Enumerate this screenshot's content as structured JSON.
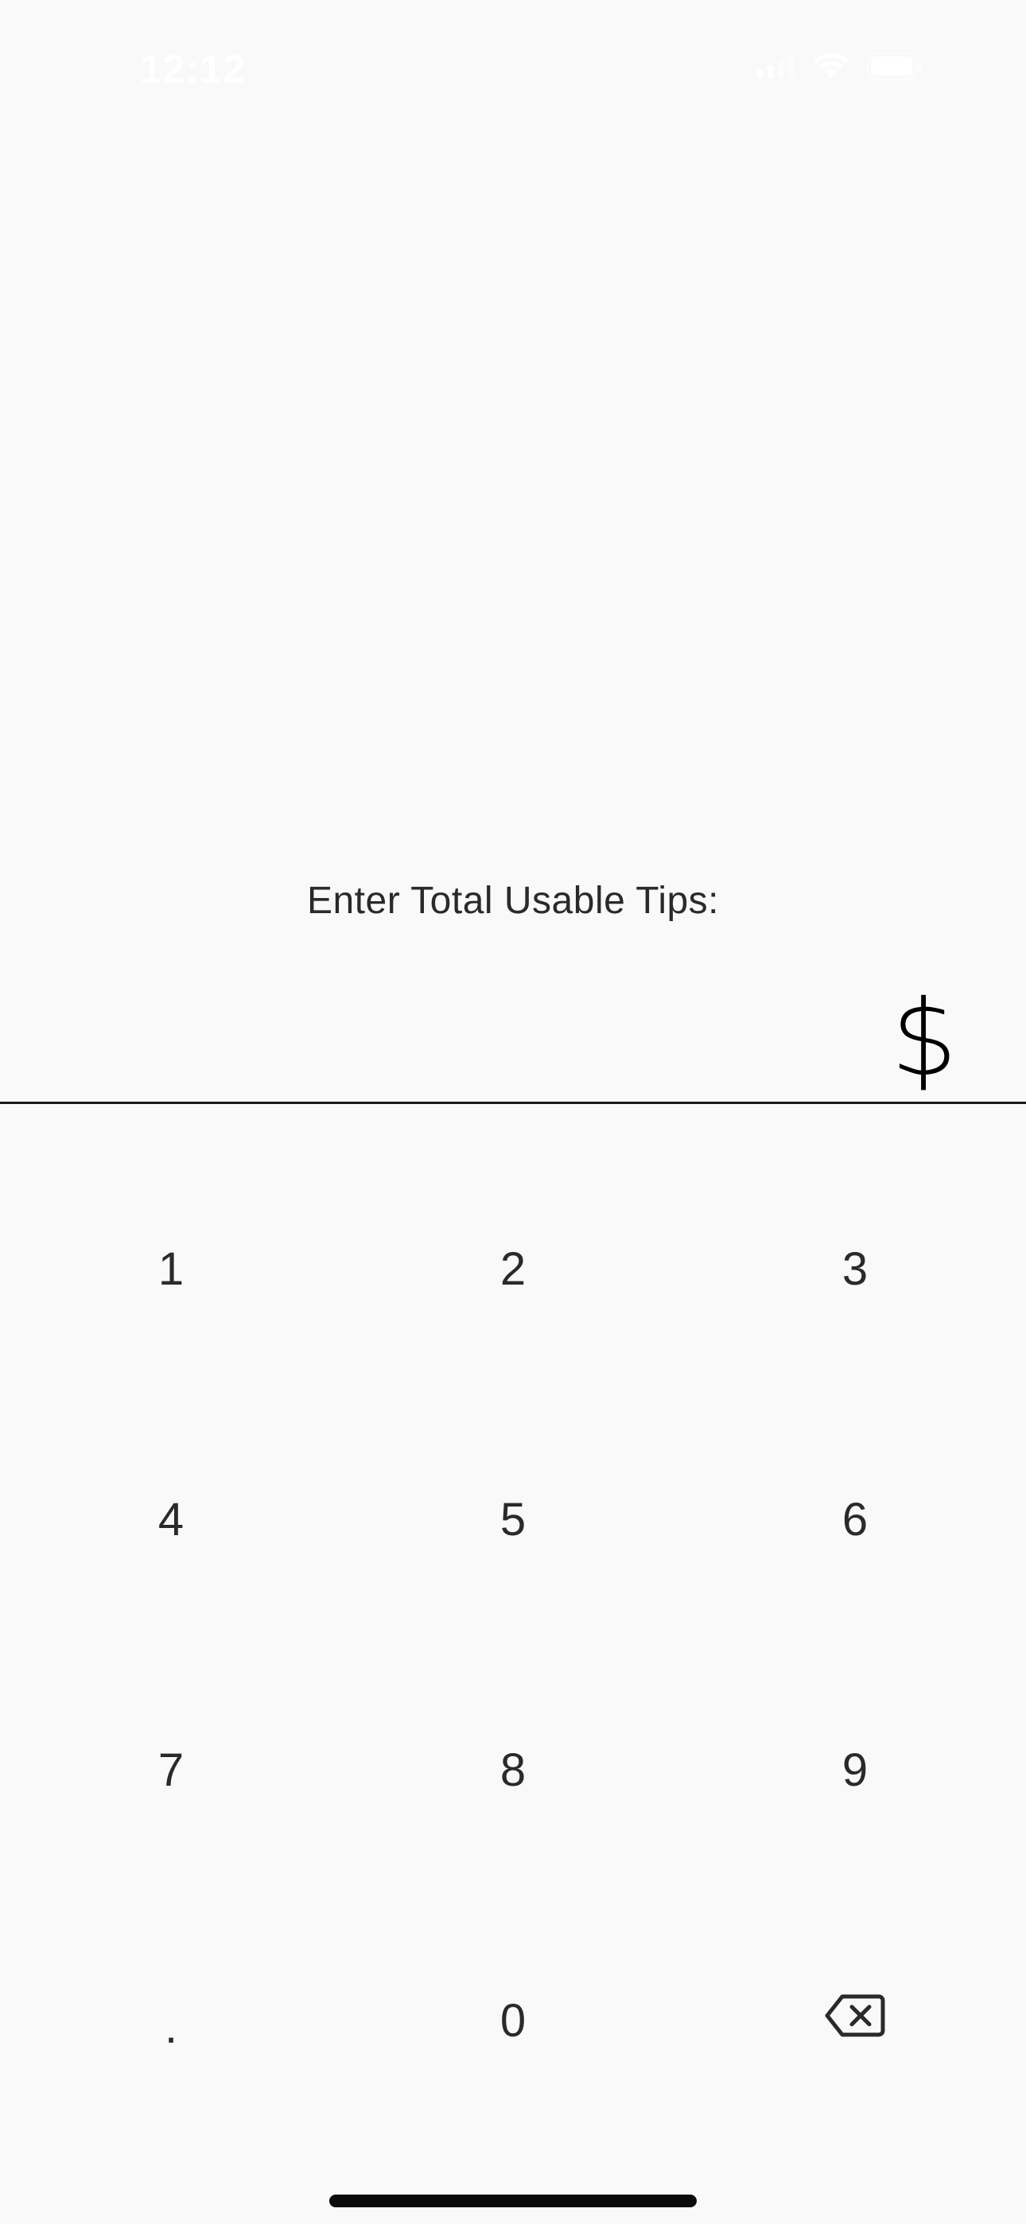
{
  "status_bar": {
    "time": "12:12",
    "icons": [
      "signal-icon",
      "wifi-icon",
      "battery-icon"
    ],
    "icon_color": "#ffffff"
  },
  "prompt": {
    "label": "Enter Total Usable Tips:"
  },
  "amount_field": {
    "value": "",
    "currency_symbol": "$"
  },
  "keypad": {
    "keys": [
      "1",
      "2",
      "3",
      "4",
      "5",
      "6",
      "7",
      "8",
      "9",
      ".",
      "0"
    ],
    "backspace_icon": "backspace-icon"
  },
  "colors": {
    "background": "#f9f9f9",
    "text": "#2a2a2c",
    "divider": "#1a1a1a"
  }
}
